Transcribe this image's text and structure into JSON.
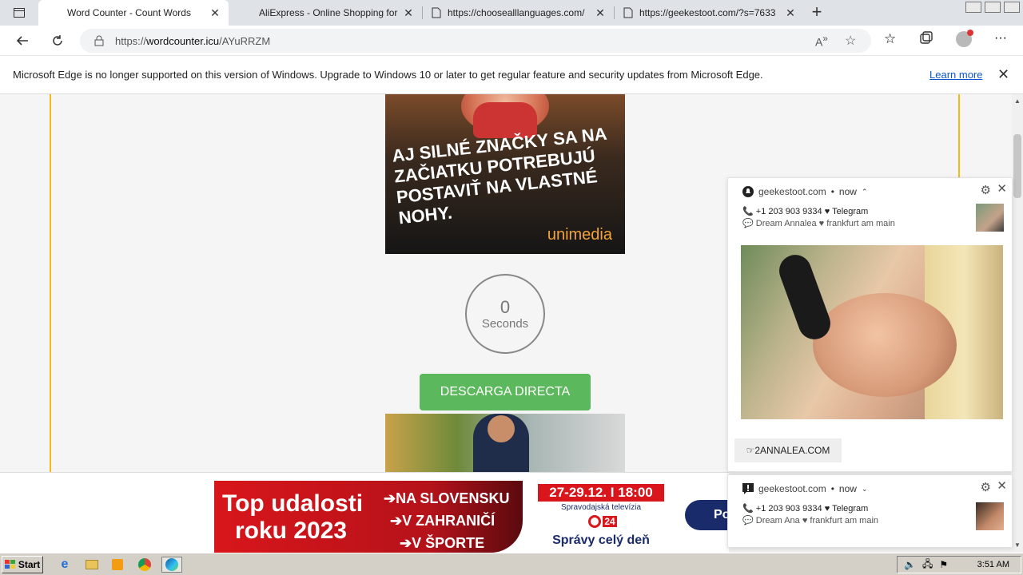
{
  "browser": {
    "tabs": [
      {
        "title": "Word Counter - Count Words",
        "active": true
      },
      {
        "title": "AliExpress - Online Shopping for",
        "active": false
      },
      {
        "title": "https://choosealllanguages.com/",
        "active": false
      },
      {
        "title": "https://geekestoot.com/?s=7633",
        "active": false
      }
    ],
    "new_tab_label": "+",
    "address": {
      "scheme": "https://",
      "host": "wordcounter.icu",
      "path": "/AYuRRZM"
    }
  },
  "infobar": {
    "message": "Microsoft Edge is no longer supported on this version of Windows. Upgrade to Windows 10 or later to get regular feature and security updates from Microsoft Edge.",
    "learn_more": "Learn more"
  },
  "page": {
    "ad_top": {
      "slogan": "AJ SILNÉ ZNAČKY SA NA ZAČIATKU POTREBUJÚ POSTAVIŤ NA VLASTNÉ NOHY.",
      "brand": "unimedia"
    },
    "timer": {
      "value": "0",
      "label": "Seconds"
    },
    "download_button": "DESCARGA DIRECTA",
    "accent_color": "#f5b816",
    "button_color": "#5cb85c"
  },
  "bottom_ad": {
    "title_line1": "Top udalosti",
    "title_line2": "roku 2023",
    "items": [
      "NA SLOVENSKU",
      "V ZAHRANIČÍ",
      "V ŠPORTE"
    ],
    "date": "27-29.12. I 18:00",
    "subtitle": "Spravodajská televízia",
    "logo_text": "24",
    "footer": "Správy celý deň",
    "cta": "Po"
  },
  "notifications": [
    {
      "site": "geekestoot.com",
      "time": "now",
      "line1": "+1 203 903 9334 ♥ Telegram",
      "line2": "Dream Annalea ♥ frankfurt am main",
      "action": "☞2ANNALEA.COM"
    },
    {
      "site": "geekestoot.com",
      "time": "now",
      "line1": "+1 203 903 9334 ♥ Telegram",
      "line2": "Dream Ana ♥ frankfurt am main"
    }
  ],
  "taskbar": {
    "start_label": "Start",
    "clock": "3:51 AM"
  }
}
